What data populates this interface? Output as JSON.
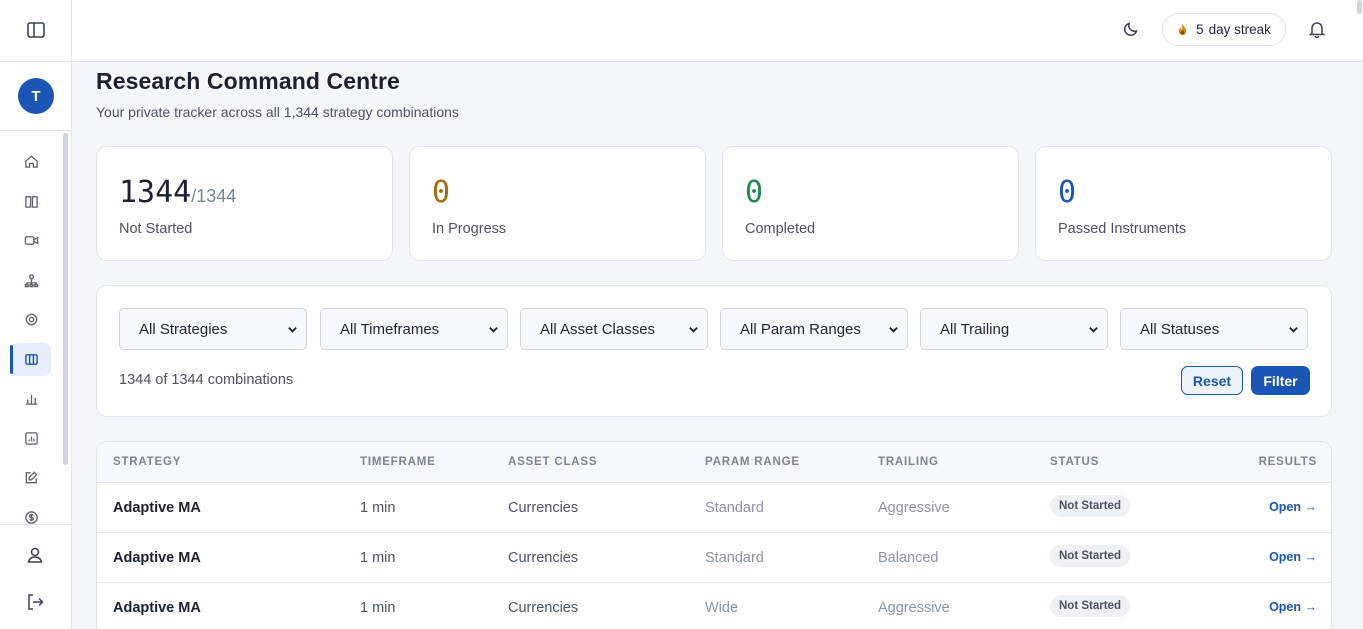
{
  "sidebar": {
    "avatar_initial": "T",
    "nav_icons": [
      "home-icon",
      "book-icon",
      "video-icon",
      "network-icon",
      "gear-icon",
      "grid-icon",
      "bar-chart-icon",
      "chart-box-icon",
      "edit-icon",
      "dollar-icon"
    ],
    "active_index": 5
  },
  "topbar": {
    "streak_count": "5",
    "streak_label": "day streak"
  },
  "header": {
    "title": "Research Command Centre",
    "subtitle": "Your private tracker across all 1,344 strategy combinations"
  },
  "stats": [
    {
      "value": "1344",
      "denominator": "/1344",
      "label": "Not Started",
      "color": "#1b2130"
    },
    {
      "value": "0",
      "label": "In Progress",
      "color": "#a8690a"
    },
    {
      "value": "0",
      "label": "Completed",
      "color": "#1e8a4f"
    },
    {
      "value": "0",
      "label": "Passed Instruments",
      "color": "#1a56b8"
    }
  ],
  "filters": {
    "selects": [
      "All Strategies",
      "All Timeframes",
      "All Asset Classes",
      "All Param Ranges",
      "All Trailing",
      "All Statuses"
    ],
    "count_text": "1344 of 1344 combinations",
    "reset_label": "Reset",
    "filter_label": "Filter"
  },
  "table": {
    "headers": [
      "STRATEGY",
      "TIMEFRAME",
      "ASSET CLASS",
      "PARAM RANGE",
      "TRAILING",
      "STATUS",
      "RESULTS"
    ],
    "rows": [
      {
        "strategy": "Adaptive MA",
        "timeframe": "1 min",
        "asset_class": "Currencies",
        "param_range": "Standard",
        "trailing": "Aggressive",
        "status": "Not Started",
        "results": "Open →"
      },
      {
        "strategy": "Adaptive MA",
        "timeframe": "1 min",
        "asset_class": "Currencies",
        "param_range": "Standard",
        "trailing": "Balanced",
        "status": "Not Started",
        "results": "Open →"
      },
      {
        "strategy": "Adaptive MA",
        "timeframe": "1 min",
        "asset_class": "Currencies",
        "param_range": "Wide",
        "trailing": "Aggressive",
        "status": "Not Started",
        "results": "Open →"
      }
    ]
  }
}
